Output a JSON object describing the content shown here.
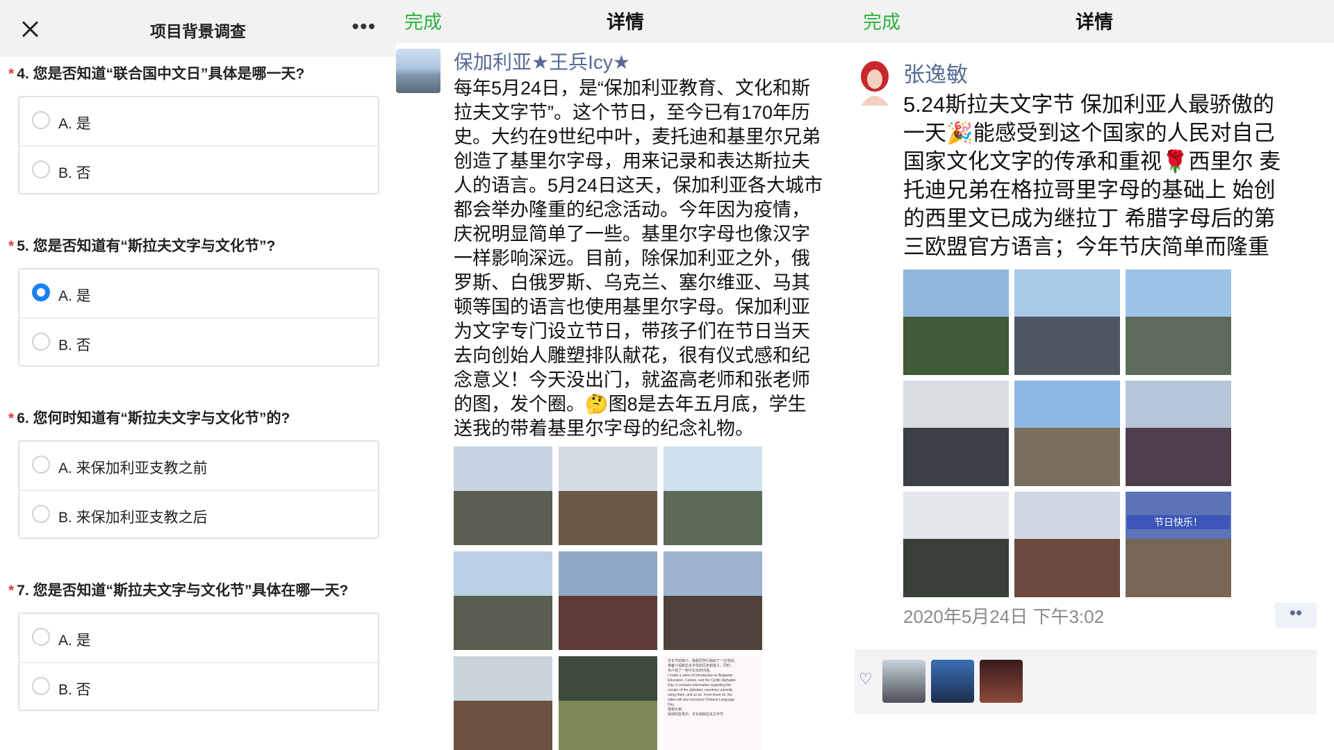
{
  "survey": {
    "title": "项目背景调查",
    "close_icon": "close-icon",
    "more_icon": "more-icon",
    "questions": [
      {
        "star": "*",
        "text": "4. 您是否知道“联合国中文日”具体是哪一天?",
        "options": [
          {
            "label": "A. 是",
            "selected": false
          },
          {
            "label": "B. 否",
            "selected": false
          }
        ]
      },
      {
        "star": "*",
        "text": "5. 您是否知道有“斯拉夫文字与文化节”?",
        "options": [
          {
            "label": "A. 是",
            "selected": true
          },
          {
            "label": "B. 否",
            "selected": false
          }
        ]
      },
      {
        "star": "*",
        "text": "6. 您何时知道有“斯拉夫文字与文化节”的?",
        "options": [
          {
            "label": "A. 来保加利亚支教之前",
            "selected": false
          },
          {
            "label": "B. 来保加利亚支教之后",
            "selected": false
          }
        ]
      },
      {
        "star": "*",
        "text": "7. 您是否知道“斯拉夫文字与文化节”具体在哪一天?",
        "options": [
          {
            "label": "A. 是",
            "selected": false
          },
          {
            "label": "B. 否",
            "selected": false
          }
        ]
      }
    ]
  },
  "post1": {
    "header": {
      "done": "完成",
      "title": "详情"
    },
    "author": "保加利亚★王兵Icy★",
    "lines": [
      "每年5月24日，是“保加利亚教育、文化和斯",
      "拉夫文字节”。这个节日，至今已有170年历",
      "史。大约在9世纪中叶，麦托迪和基里尔兄弟",
      "创造了基里尔字母，用来记录和表达斯拉夫",
      "人的语言。5月24日这天，保加利亚各大城市",
      "都会举办隆重的纪念活动。今年因为疫情，",
      "庆祝明显简单了一些。基里尔字母也像汉字",
      "一样影响深远。目前，除保加利亚之外，俄",
      "罗斯、白俄罗斯、乌克兰、塞尔维亚、马其",
      "顿等国的语言也使用基里尔字母。保加利亚",
      "为文字专门设立节日，带孩子们在节日当天",
      "去向创始人雕塑排队献花，很有仪式感和纪",
      "念意义！今天没出门，就盗高老师和张老师",
      "的图，发个圈。🤔图8是去年五月底，学生",
      "送我的带着基里尔字母的纪念礼物。"
    ],
    "photos": [
      {
        "sky": "#c7d3e0",
        "ground": "#5a5f52"
      },
      {
        "sky": "#d3dbe4",
        "ground": "#6b5a48"
      },
      {
        "sky": "#cfe0ee",
        "ground": "#5c6a58"
      },
      {
        "sky": "#b9cfe3",
        "ground": "#585d50"
      },
      {
        "sky": "#8fa7c6",
        "ground": "#5b3a38"
      },
      {
        "sky": "#9db3cf",
        "ground": "#50403c"
      },
      {
        "sky": "#c9d4d9",
        "ground": "#6e5040"
      },
      {
        "sky": "#3b4a3b",
        "ground": "#7f8a5b"
      },
      {
        "sky": "#f3f0f2",
        "ground": "#e8dde2"
      }
    ],
    "photo8_text": [
      "文化节的简介。我和同学们组织了一次活动，",
      "准备介绍斯拉夫字母的历史和意义。同时，",
      "也介绍了一些中文日的内容。",
      "I made a video of Introduction to Bulgarian",
      "Education, Culture, and the Cyrillic Alphabet",
      "Day. It contains information regarding the",
      "creator of the alphabet, countries currently",
      "using them, and so on. From there on, the",
      "video will also introduce Chinese Language",
      "Day.",
      "感谢大家。",
      "保加利亚高中，文化和斯拉夫文字节"
    ]
  },
  "post2": {
    "header": {
      "done": "完成",
      "title": "详情"
    },
    "author": "张逸敏",
    "lines": [
      "5.24斯拉夫文字节 保加利亚人最骄傲的",
      "一天🎉能感受到这个国家的人民对自己",
      "国家文化文字的传承和重视🌹西里尔 麦",
      "托迪兄弟在格拉哥里字母的基础上 始创",
      "的西里文已成为继拉丁 希腊字母后的第",
      "三欧盟官方语言；今年节庆简单而隆重"
    ],
    "photos": [
      {
        "sky": "#8fb7de",
        "ground": "#3f5a36"
      },
      {
        "sky": "#a8c8e8",
        "ground": "#4d5661"
      },
      {
        "sky": "#9cc4ea",
        "ground": "#5f6b5a"
      },
      {
        "sky": "#d8dde2",
        "ground": "#3d3f46"
      },
      {
        "sky": "#8db6e4",
        "ground": "#7a6f5c"
      },
      {
        "sky": "#b6c6d8",
        "ground": "#4f3f4c"
      },
      {
        "sky": "#e3e6ea",
        "ground": "#3a3f3a"
      },
      {
        "sky": "#cfd8e2",
        "ground": "#6b4a42"
      },
      {
        "sky": "#5c74b8",
        "ground": "#7a6656"
      }
    ],
    "banner_text": "节日快乐！",
    "time": "2020年5月24日 下午3:02",
    "dots": "••",
    "heart_icon": "heart-icon",
    "likers": [
      {
        "color_top": "#c9d2dc",
        "color_bottom": "#4b4f58"
      },
      {
        "color_top": "#3b6fb5",
        "color_bottom": "#1d2e4f"
      },
      {
        "color_top": "#3a1a1c",
        "color_bottom": "#8a4a3a"
      }
    ]
  }
}
